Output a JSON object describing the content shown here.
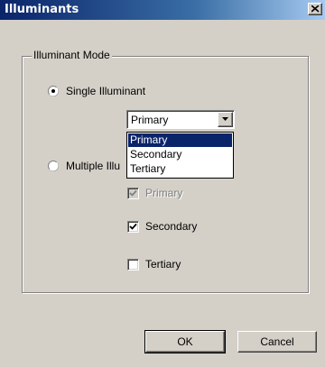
{
  "window": {
    "title": "Illuminants",
    "close_glyph": "x"
  },
  "group": {
    "label": "Illuminant Mode"
  },
  "radios": {
    "single": {
      "label": "Single Illuminant",
      "checked": true
    },
    "multiple": {
      "label": "Multiple Illu",
      "checked": false
    }
  },
  "combo": {
    "value": "Primary",
    "options": [
      "Primary",
      "Secondary",
      "Tertiary"
    ],
    "highlighted_index": 0
  },
  "checkboxes": {
    "primary": {
      "label": "Primary",
      "checked": true,
      "enabled": false
    },
    "secondary": {
      "label": "Secondary",
      "checked": true,
      "enabled": true
    },
    "tertiary": {
      "label": "Tertiary",
      "checked": false,
      "enabled": true
    }
  },
  "buttons": {
    "ok": "OK",
    "cancel": "Cancel"
  },
  "colors": {
    "title_bar": "#0a246a",
    "highlight": "#0a246a",
    "face": "#d4d0c8"
  },
  "icons": {
    "close": "close-icon",
    "dropdown": "chevron-down-icon",
    "check": "check-icon"
  }
}
